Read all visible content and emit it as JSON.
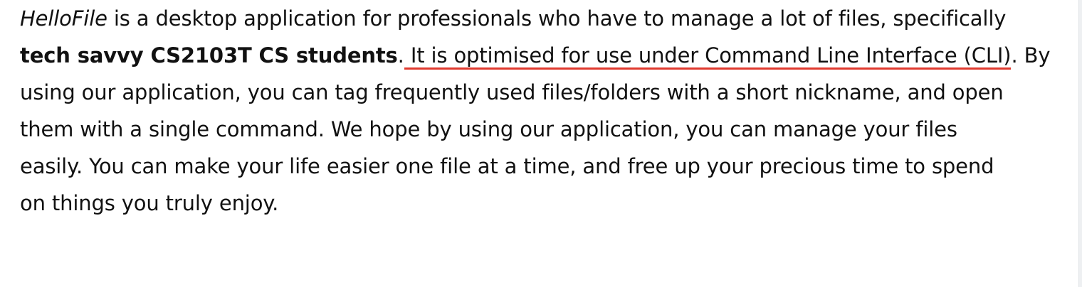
{
  "document": {
    "line1": {
      "app_name": "HelloFile",
      "text": " is a desktop application for professionals who have to manage a lot of files, specifically"
    },
    "line2": {
      "bold_text": "tech savvy CS2103T CS students",
      "before_highlight": ".",
      "highlight_text": " It is optimised for use under Command Line Interface (CLI)",
      "after_highlight": ". By"
    },
    "line3": "using our application, you can tag frequently used files/folders with a short nickname, and open",
    "line4": "them with a single command. We hope by using our application, you can manage your files",
    "line5": "easily. You can make your life easier one file at a time, and free up your precious time to spend",
    "line6": "on things you truly enjoy."
  },
  "colors": {
    "text": "#111111",
    "highlight_underline": "#e03a2f",
    "background": "#ffffff"
  }
}
